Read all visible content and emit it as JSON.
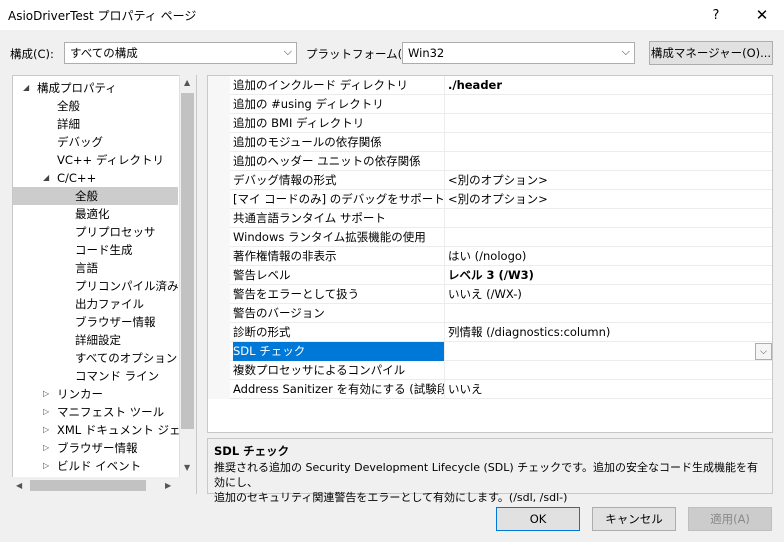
{
  "window": {
    "title": "AsioDriverTest プロパティ ページ",
    "help_label": "?",
    "close_label": "✕"
  },
  "toolbar": {
    "config_label": "構成(C):",
    "config_value": "すべての構成",
    "platform_label": "プラットフォーム(P):",
    "platform_value": "Win32",
    "config_manager_label": "構成マネージャー(O)..."
  },
  "tree": {
    "items": [
      {
        "label": "構成プロパティ",
        "indent": 1,
        "toggle": "expanded",
        "selected": false
      },
      {
        "label": "全般",
        "indent": 2,
        "toggle": "none",
        "selected": false
      },
      {
        "label": "詳細",
        "indent": 2,
        "toggle": "none",
        "selected": false
      },
      {
        "label": "デバッグ",
        "indent": 2,
        "toggle": "none",
        "selected": false
      },
      {
        "label": "VC++ ディレクトリ",
        "indent": 2,
        "toggle": "none",
        "selected": false
      },
      {
        "label": "C/C++",
        "indent": 2,
        "toggle": "expanded",
        "selected": false
      },
      {
        "label": "全般",
        "indent": 3,
        "toggle": "none",
        "selected": true
      },
      {
        "label": "最適化",
        "indent": 3,
        "toggle": "none",
        "selected": false
      },
      {
        "label": "プリプロセッサ",
        "indent": 3,
        "toggle": "none",
        "selected": false
      },
      {
        "label": "コード生成",
        "indent": 3,
        "toggle": "none",
        "selected": false
      },
      {
        "label": "言語",
        "indent": 3,
        "toggle": "none",
        "selected": false
      },
      {
        "label": "プリコンパイル済みヘッ",
        "indent": 3,
        "toggle": "none",
        "selected": false
      },
      {
        "label": "出力ファイル",
        "indent": 3,
        "toggle": "none",
        "selected": false
      },
      {
        "label": "ブラウザー情報",
        "indent": 3,
        "toggle": "none",
        "selected": false
      },
      {
        "label": "詳細設定",
        "indent": 3,
        "toggle": "none",
        "selected": false
      },
      {
        "label": "すべてのオプション",
        "indent": 3,
        "toggle": "none",
        "selected": false
      },
      {
        "label": "コマンド ライン",
        "indent": 3,
        "toggle": "none",
        "selected": false
      },
      {
        "label": "リンカー",
        "indent": 2,
        "toggle": "collapsed",
        "selected": false
      },
      {
        "label": "マニフェスト ツール",
        "indent": 2,
        "toggle": "collapsed",
        "selected": false
      },
      {
        "label": "XML ドキュメント ジェネレー",
        "indent": 2,
        "toggle": "collapsed",
        "selected": false
      },
      {
        "label": "ブラウザー情報",
        "indent": 2,
        "toggle": "collapsed",
        "selected": false
      },
      {
        "label": "ビルド イベント",
        "indent": 2,
        "toggle": "collapsed",
        "selected": false
      }
    ]
  },
  "properties": {
    "rows": [
      {
        "name": "追加のインクルード ディレクトリ",
        "value": "./header",
        "bold": true,
        "selected": false
      },
      {
        "name": "追加の #using ディレクトリ",
        "value": "",
        "bold": false,
        "selected": false
      },
      {
        "name": "追加の BMI ディレクトリ",
        "value": "",
        "bold": false,
        "selected": false
      },
      {
        "name": "追加のモジュールの依存関係",
        "value": "",
        "bold": false,
        "selected": false
      },
      {
        "name": "追加のヘッダー ユニットの依存関係",
        "value": "",
        "bold": false,
        "selected": false
      },
      {
        "name": "デバッグ情報の形式",
        "value": "<別のオプション>",
        "bold": false,
        "selected": false
      },
      {
        "name": "[マイ コードのみ] のデバッグをサポートする",
        "value": "<別のオプション>",
        "bold": false,
        "selected": false
      },
      {
        "name": "共通言語ランタイム サポート",
        "value": "",
        "bold": false,
        "selected": false
      },
      {
        "name": "Windows ランタイム拡張機能の使用",
        "value": "",
        "bold": false,
        "selected": false
      },
      {
        "name": "著作権情報の非表示",
        "value": "はい (/nologo)",
        "bold": false,
        "selected": false
      },
      {
        "name": "警告レベル",
        "value": "レベル 3 (/W3)",
        "bold": true,
        "selected": false
      },
      {
        "name": "警告をエラーとして扱う",
        "value": "いいえ (/WX-)",
        "bold": false,
        "selected": false
      },
      {
        "name": "警告のバージョン",
        "value": "",
        "bold": false,
        "selected": false
      },
      {
        "name": "診断の形式",
        "value": "列情報 (/diagnostics:column)",
        "bold": false,
        "selected": false
      },
      {
        "name": "SDL チェック",
        "value": "",
        "bold": false,
        "selected": true
      },
      {
        "name": "複数プロセッサによるコンパイル",
        "value": "",
        "bold": false,
        "selected": false
      },
      {
        "name": "Address Sanitizer を有効にする (試験段階",
        "value": "いいえ",
        "bold": false,
        "selected": false
      }
    ]
  },
  "description": {
    "title": "SDL チェック",
    "line1": "推奨される追加の Security Development Lifecycle (SDL) チェックです。追加の安全なコード生成機能を有効にし、",
    "line2": "追加のセキュリティ関連警告をエラーとして有効にします。(/sdl, /sdl-)"
  },
  "buttons": {
    "ok": "OK",
    "cancel": "キャンセル",
    "apply": "適用(A)"
  },
  "colors": {
    "selection_blue": "#0078d7",
    "tree_selection": "#cccccc"
  }
}
